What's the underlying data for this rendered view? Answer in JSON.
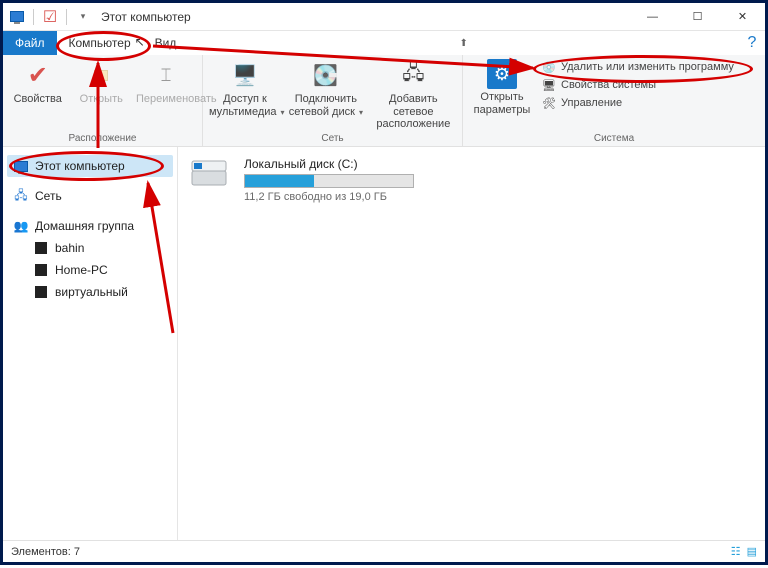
{
  "titlebar": {
    "title": "Этот компьютер",
    "min": "—",
    "max": "☐",
    "close": "✕"
  },
  "tabs": {
    "file": "Файл",
    "computer": "Компьютер",
    "view": "Вид"
  },
  "ribbon": {
    "group1": {
      "name": "Расположение",
      "properties": "Свойства",
      "open": "Открыть",
      "rename": "Переименовать"
    },
    "group2": {
      "name": "Сеть",
      "media": "Доступ к мультимедиа",
      "mapdrive": "Подключить сетевой диск",
      "addloc": "Добавить сетевое расположение"
    },
    "group3": {
      "name": "Система",
      "settings": "Открыть параметры",
      "uninstall": "Удалить или изменить программу",
      "sysprops": "Свойства системы",
      "manage": "Управление"
    }
  },
  "nav": {
    "thispc": "Этот компьютер",
    "network": "Сеть",
    "homegroup": "Домашняя группа",
    "items": [
      "bahin",
      "Home-PC",
      "виртуальный"
    ]
  },
  "content": {
    "drive_name": "Локальный диск (C:)",
    "drive_sub": "11,2 ГБ свободно из 19,0 ГБ",
    "fill_pct": 41
  },
  "status": {
    "count": "Элементов: 7"
  }
}
